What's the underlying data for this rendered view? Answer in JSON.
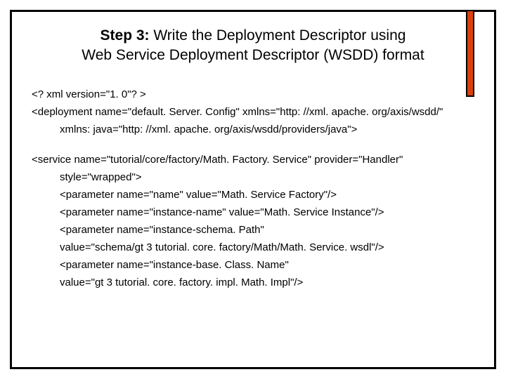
{
  "title": {
    "prefix": "Step 3:",
    "rest1": "  Write the Deployment Descriptor using",
    "rest2": "Web Service Deployment Descriptor (WSDD) format"
  },
  "code": {
    "l1": "<? xml version=\"1. 0\"? >",
    "l2": "<deployment name=\"default. Server. Config\" xmlns=\"http: //xml. apache. org/axis/wsdd/\"",
    "l3": "xmlns: java=\"http: //xml. apache. org/axis/wsdd/providers/java\">",
    "s1": "<service name=\"tutorial/core/factory/Math. Factory. Service\" provider=\"Handler\"",
    "s2": "style=\"wrapped\">",
    "s3": "<parameter name=\"name\" value=\"Math. Service Factory\"/>",
    "s4": "<parameter name=\"instance-name\" value=\"Math. Service Instance\"/>",
    "s5": "<parameter name=\"instance-schema. Path\"",
    "s6": "value=\"schema/gt 3 tutorial. core. factory/Math/Math. Service. wsdl\"/>",
    "s7": "<parameter name=\"instance-base. Class. Name\"",
    "s8": "value=\"gt 3 tutorial. core. factory. impl. Math. Impl\"/>"
  }
}
